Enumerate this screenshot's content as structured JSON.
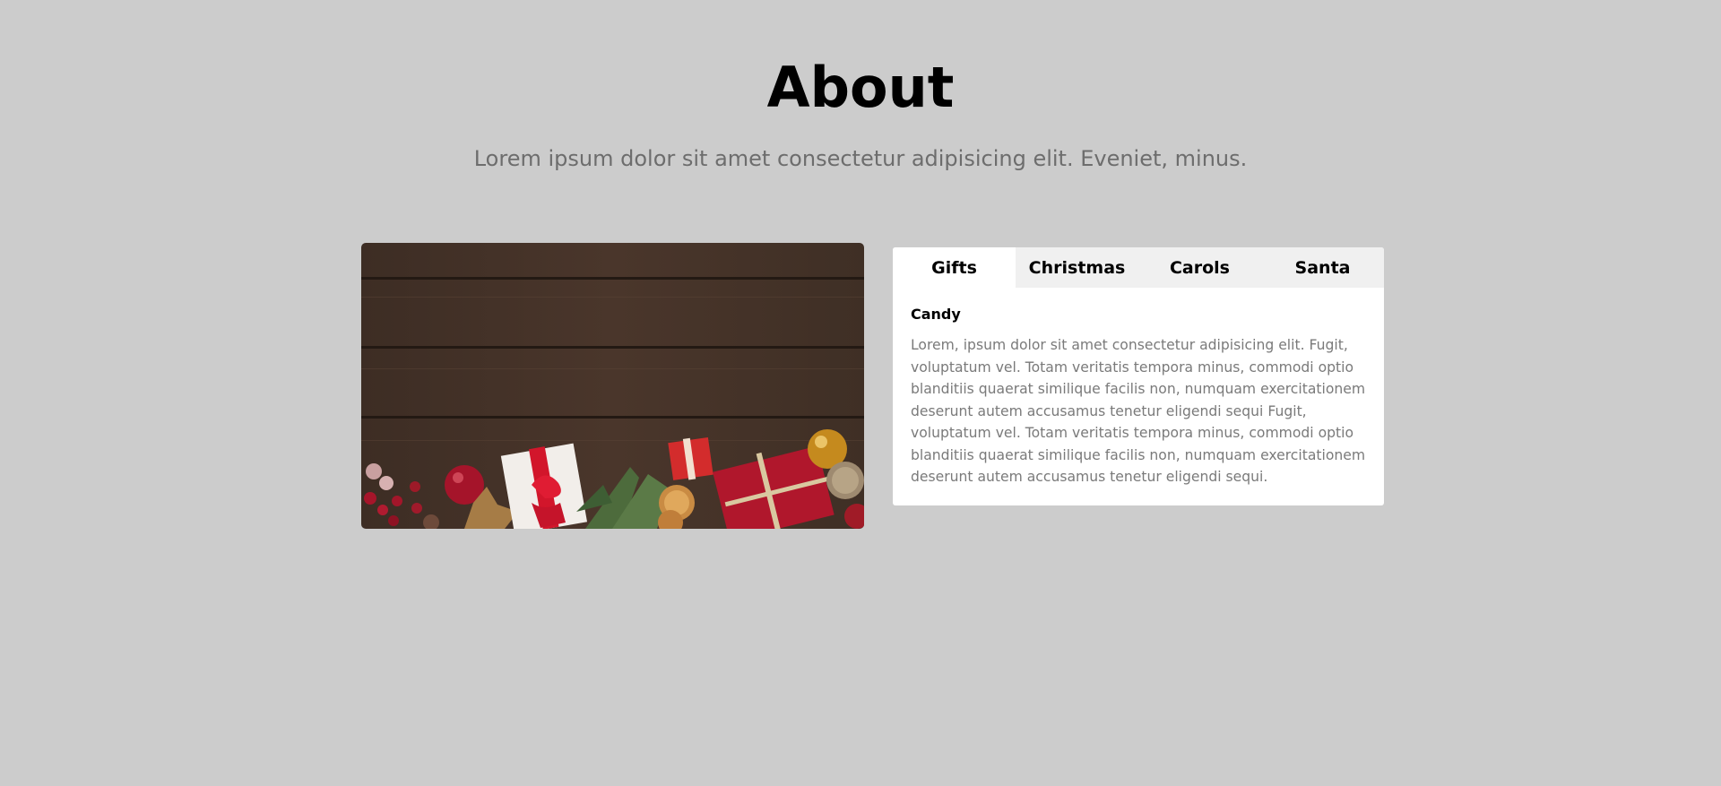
{
  "about": {
    "title": "About",
    "subtitle": "Lorem ipsum dolor sit amet consectetur adipisicing elit. Eveniet, minus."
  },
  "hero_image": {
    "icon": "christmas-gifts-photo"
  },
  "tabs": [
    {
      "label": "Gifts",
      "active": true
    },
    {
      "label": "Christmas",
      "active": false
    },
    {
      "label": "Carols",
      "active": false
    },
    {
      "label": "Santa",
      "active": false
    }
  ],
  "panel": {
    "title": "Candy",
    "text": "Lorem, ipsum dolor sit amet consectetur adipisicing elit. Fugit, voluptatum vel. Totam veritatis tempora minus, commodi optio blanditiis quaerat similique facilis non, numquam exercitationem deserunt autem accusamus tenetur eligendi sequi Fugit, voluptatum vel. Totam veritatis tempora minus, commodi optio blanditiis quaerat similique facilis non, numquam exercitationem deserunt autem accusamus tenetur eligendi sequi."
  },
  "colors": {
    "background": "#cccccc",
    "card": "#ffffff",
    "tab_bar": "#f0f0f0",
    "subtitle": "#6d6d6d",
    "body_text": "#7a7a7a"
  }
}
